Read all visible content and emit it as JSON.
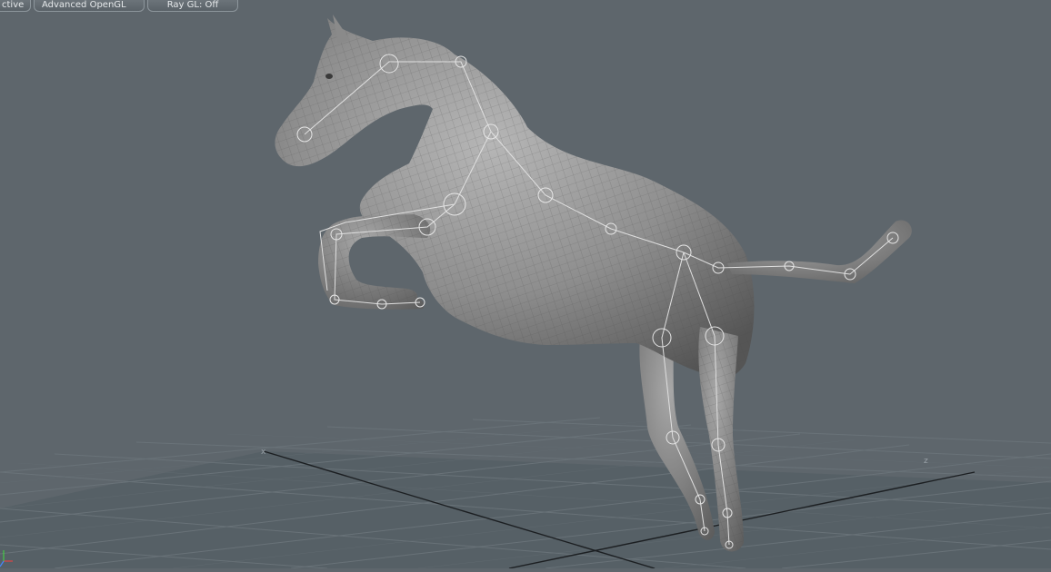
{
  "toolbar": {
    "view_mode_label": "ctive",
    "render_mode_label": "Advanced OpenGL",
    "raygl_label": "Ray GL: Off"
  },
  "viewport": {
    "axis_x_label": "x",
    "axis_z_label": "z",
    "subject": "horse mesh with skeleton rig",
    "colors": {
      "background": "#5e666c",
      "grid_line": "#6a7278",
      "mesh": "#8c8c8c",
      "bone": "#dcdcdc"
    }
  }
}
